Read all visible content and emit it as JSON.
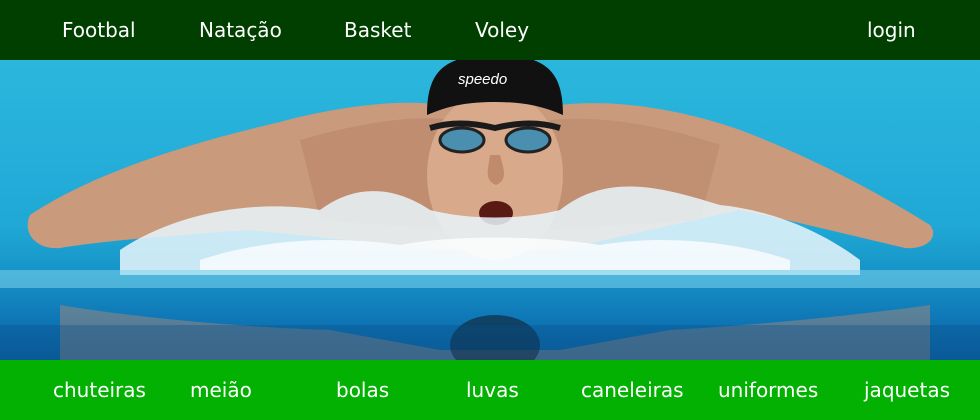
{
  "top_nav": {
    "items": [
      {
        "label": "Footbal"
      },
      {
        "label": "Natação"
      },
      {
        "label": "Basket"
      },
      {
        "label": "Voley"
      }
    ],
    "login_label": "login"
  },
  "hero": {
    "cap_brand": "speedo"
  },
  "category_nav": {
    "items": [
      {
        "label": "chuteiras"
      },
      {
        "label": "meião"
      },
      {
        "label": "bolas"
      },
      {
        "label": "luvas"
      },
      {
        "label": "caneleiras"
      },
      {
        "label": "uniformes"
      },
      {
        "label": "jaquetas"
      }
    ]
  },
  "colors": {
    "top_bar": "#013f01",
    "bottom_bar": "#02b102",
    "text": "#ffffff",
    "water": "#20a8d6"
  }
}
